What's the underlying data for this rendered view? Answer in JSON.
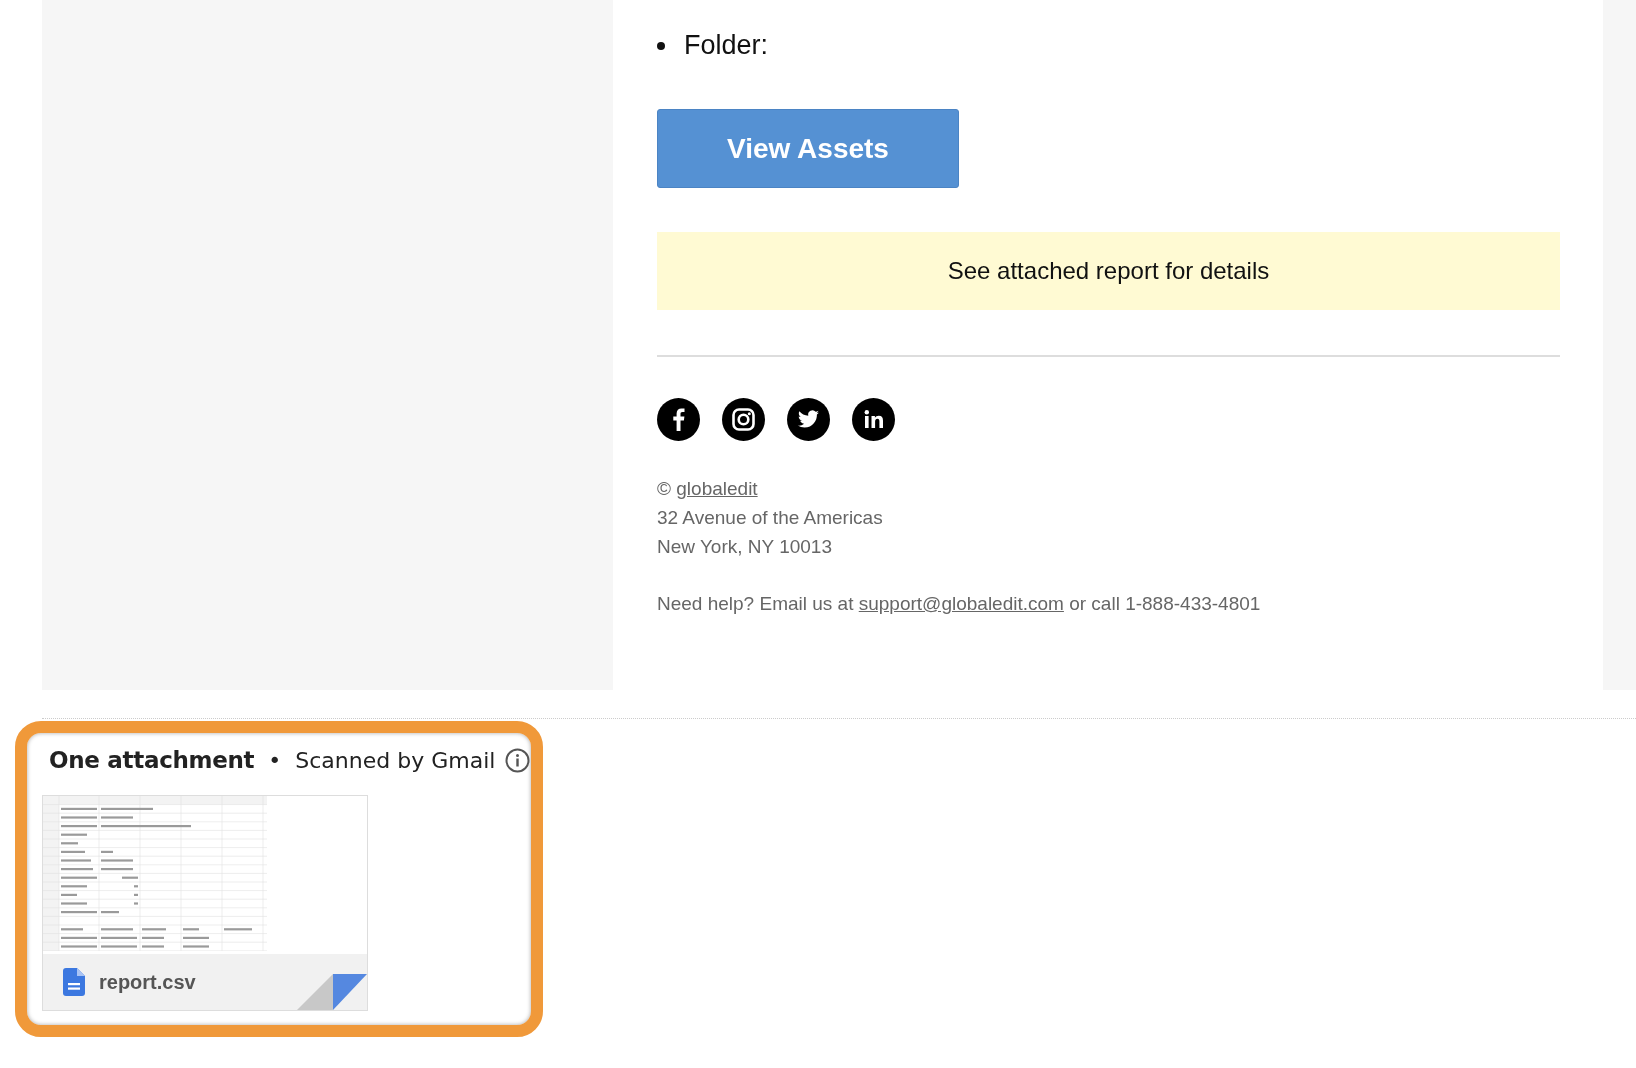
{
  "email": {
    "list_items": [
      "Folder:"
    ],
    "button": "View Assets",
    "notice": "See attached report for details",
    "footer": {
      "copyright_symbol": "©",
      "company_link": "globaledit",
      "address_lines": [
        "32 Avenue of the Americas",
        "New York, NY 10013"
      ],
      "help": {
        "before": "Need help? Email us at",
        "email_link": "support@globaledit.com",
        "after": "or call 1-888-433-4801"
      }
    }
  },
  "attachments": {
    "title": "One attachment",
    "separator": "•",
    "scan_note": "Scanned by Gmail",
    "files": [
      {
        "name": "report.csv"
      }
    ]
  }
}
